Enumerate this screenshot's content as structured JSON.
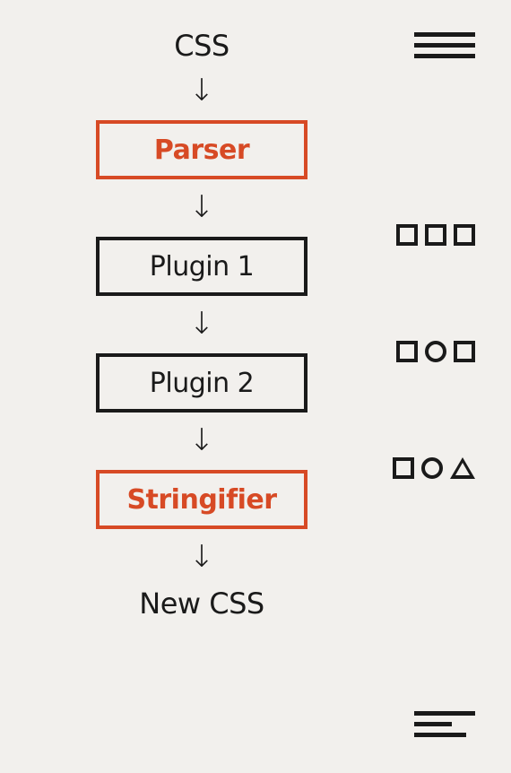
{
  "pipeline": {
    "input": "CSS",
    "parser": "Parser",
    "plugin1": "Plugin 1",
    "plugin2": "Plugin 2",
    "stringifier": "Stringifier",
    "output": "New CSS"
  },
  "symbols": {
    "input_repr": "justified-lines",
    "after_parser": [
      "square",
      "square",
      "square"
    ],
    "after_plugin1": [
      "square",
      "circle",
      "square"
    ],
    "after_plugin2": [
      "square",
      "circle",
      "triangle"
    ],
    "output_repr": "left-aligned-lines"
  },
  "colors": {
    "accent": "#d74a25",
    "text": "#1a1a1a",
    "background": "#f2f0ed"
  }
}
